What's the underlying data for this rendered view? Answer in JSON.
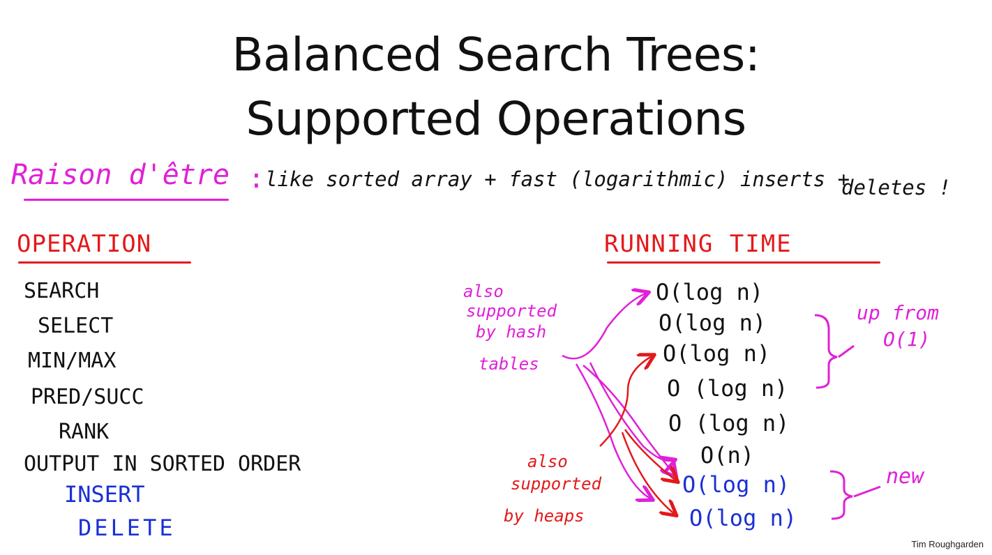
{
  "title_line1": "Balanced Search Trees:",
  "title_line2": "Supported Operations",
  "raison": {
    "label": "Raison d'être",
    "colon": ":",
    "text": "like sorted array + fast (logarithmic) inserts +",
    "text2": "deletes !"
  },
  "operation_header": "OPERATION",
  "running_time_header": "RUNNING TIME",
  "operations": [
    "SEARCH",
    "SELECT",
    "MIN/MAX",
    "PRED/SUCC",
    "RANK",
    "OUTPUT IN SORTED ORDER",
    "INSERT",
    "DELETE"
  ],
  "running_times": [
    "O(log n)",
    "O(log n)",
    "O(log n)",
    "O (log n)",
    "O (log n)",
    "O(n)",
    "O(log n)",
    "O(log n)"
  ],
  "annotations": {
    "hash_tables": [
      "also",
      "supported",
      "by hash",
      "tables"
    ],
    "heaps": [
      "also",
      "supported",
      "by heaps"
    ],
    "up_from": [
      "up from",
      "O(1)"
    ],
    "new": "new"
  },
  "footer": "Tim Roughgarden",
  "colors": {
    "black": "#111111",
    "magenta": "#e020d8",
    "red": "#e3191b",
    "blue": "#1a2fd6"
  }
}
